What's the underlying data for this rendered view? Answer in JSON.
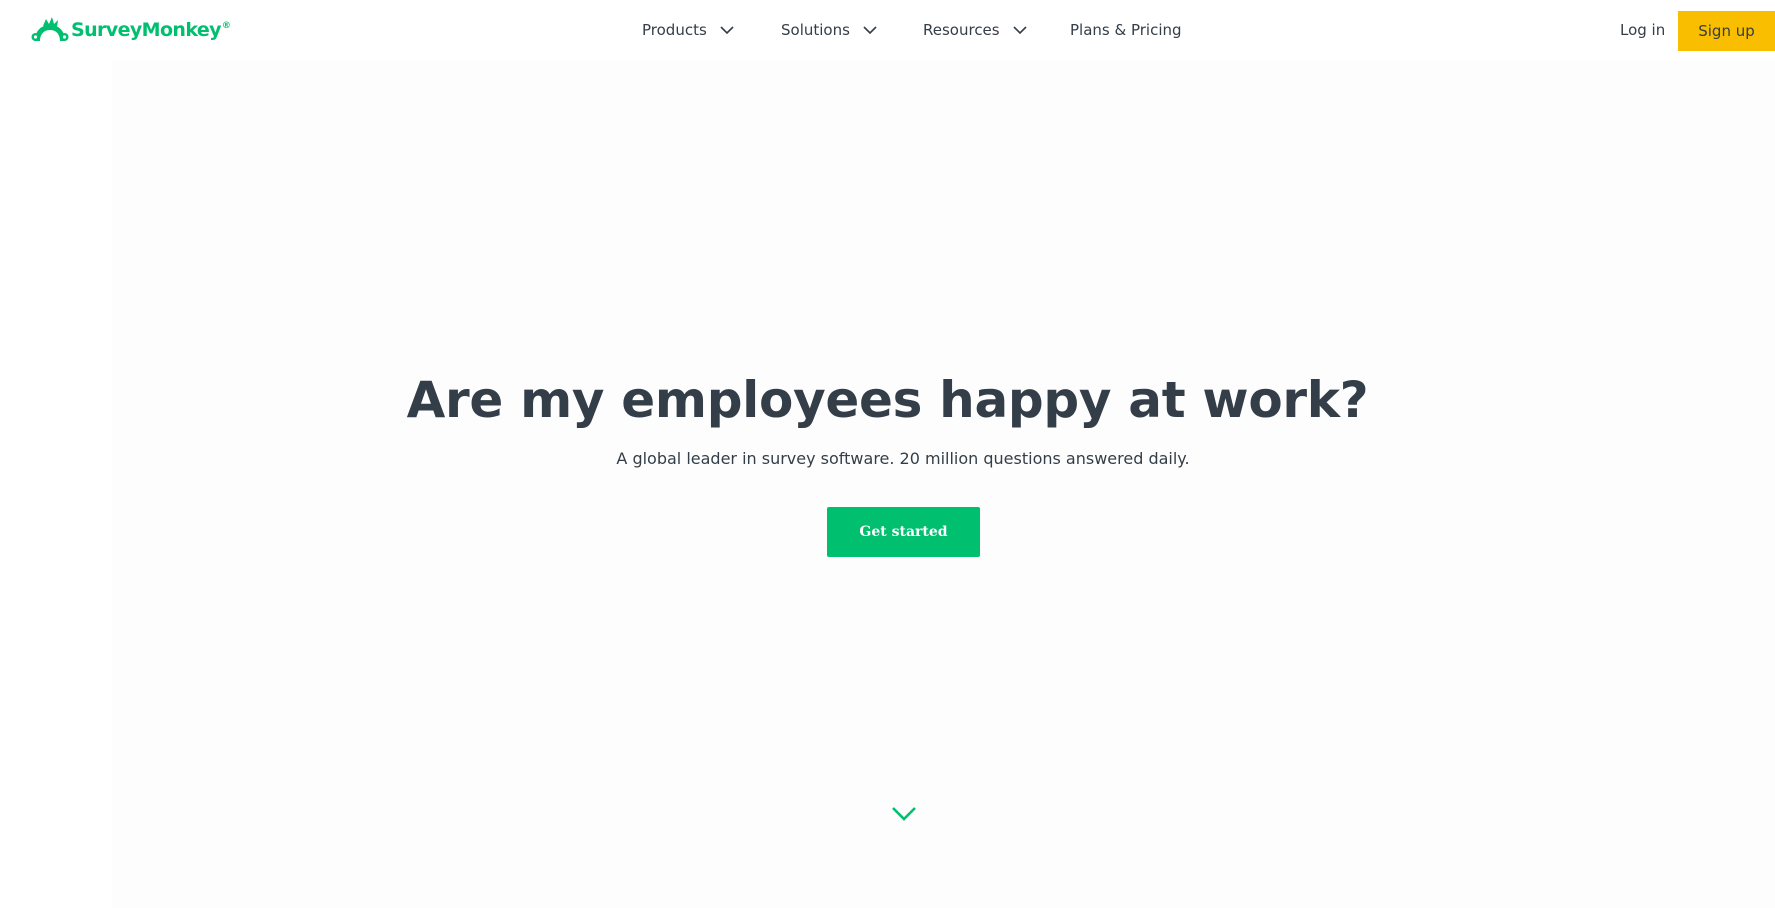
{
  "colors": {
    "brand_green": "#00bf6f",
    "sign_up_yellow": "#f9be00",
    "text_dark": "#333e48",
    "hero_background": "#fdfdfd"
  },
  "header": {
    "logo": {
      "text": "SurveyMonkey",
      "trademark": "®",
      "icon": "monkey-logo-icon"
    },
    "nav": [
      {
        "label": "Products",
        "icon": "chevron-down-icon"
      },
      {
        "label": "Solutions",
        "icon": "chevron-down-icon"
      },
      {
        "label": "Resources",
        "icon": "chevron-down-icon"
      },
      {
        "label": "Plans & Pricing"
      }
    ],
    "login_label": "Log in",
    "signup_label": "Sign up"
  },
  "hero": {
    "headline": "Are my employees happy at work?",
    "subheadline": "A global leader in survey software. 20 million questions answered daily.",
    "cta_label": "Get started",
    "scroll_icon": "chevron-down-icon"
  }
}
